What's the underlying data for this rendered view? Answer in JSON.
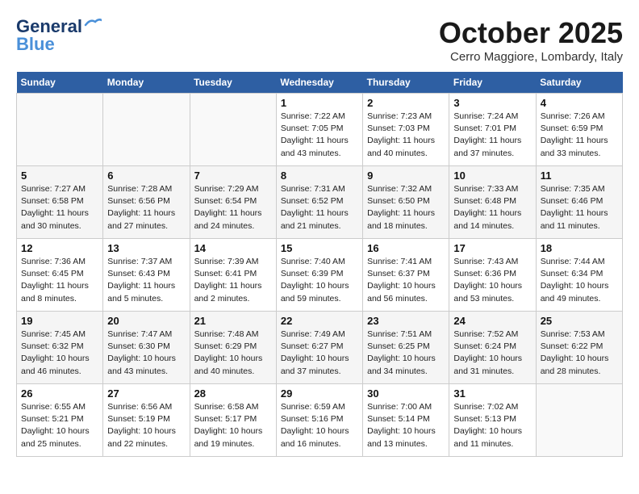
{
  "header": {
    "logo_line1": "General",
    "logo_line2": "Blue",
    "month": "October 2025",
    "location": "Cerro Maggiore, Lombardy, Italy"
  },
  "weekdays": [
    "Sunday",
    "Monday",
    "Tuesday",
    "Wednesday",
    "Thursday",
    "Friday",
    "Saturday"
  ],
  "weeks": [
    [
      {
        "day": "",
        "info": ""
      },
      {
        "day": "",
        "info": ""
      },
      {
        "day": "",
        "info": ""
      },
      {
        "day": "1",
        "info": "Sunrise: 7:22 AM\nSunset: 7:05 PM\nDaylight: 11 hours\nand 43 minutes."
      },
      {
        "day": "2",
        "info": "Sunrise: 7:23 AM\nSunset: 7:03 PM\nDaylight: 11 hours\nand 40 minutes."
      },
      {
        "day": "3",
        "info": "Sunrise: 7:24 AM\nSunset: 7:01 PM\nDaylight: 11 hours\nand 37 minutes."
      },
      {
        "day": "4",
        "info": "Sunrise: 7:26 AM\nSunset: 6:59 PM\nDaylight: 11 hours\nand 33 minutes."
      }
    ],
    [
      {
        "day": "5",
        "info": "Sunrise: 7:27 AM\nSunset: 6:58 PM\nDaylight: 11 hours\nand 30 minutes."
      },
      {
        "day": "6",
        "info": "Sunrise: 7:28 AM\nSunset: 6:56 PM\nDaylight: 11 hours\nand 27 minutes."
      },
      {
        "day": "7",
        "info": "Sunrise: 7:29 AM\nSunset: 6:54 PM\nDaylight: 11 hours\nand 24 minutes."
      },
      {
        "day": "8",
        "info": "Sunrise: 7:31 AM\nSunset: 6:52 PM\nDaylight: 11 hours\nand 21 minutes."
      },
      {
        "day": "9",
        "info": "Sunrise: 7:32 AM\nSunset: 6:50 PM\nDaylight: 11 hours\nand 18 minutes."
      },
      {
        "day": "10",
        "info": "Sunrise: 7:33 AM\nSunset: 6:48 PM\nDaylight: 11 hours\nand 14 minutes."
      },
      {
        "day": "11",
        "info": "Sunrise: 7:35 AM\nSunset: 6:46 PM\nDaylight: 11 hours\nand 11 minutes."
      }
    ],
    [
      {
        "day": "12",
        "info": "Sunrise: 7:36 AM\nSunset: 6:45 PM\nDaylight: 11 hours\nand 8 minutes."
      },
      {
        "day": "13",
        "info": "Sunrise: 7:37 AM\nSunset: 6:43 PM\nDaylight: 11 hours\nand 5 minutes."
      },
      {
        "day": "14",
        "info": "Sunrise: 7:39 AM\nSunset: 6:41 PM\nDaylight: 11 hours\nand 2 minutes."
      },
      {
        "day": "15",
        "info": "Sunrise: 7:40 AM\nSunset: 6:39 PM\nDaylight: 10 hours\nand 59 minutes."
      },
      {
        "day": "16",
        "info": "Sunrise: 7:41 AM\nSunset: 6:37 PM\nDaylight: 10 hours\nand 56 minutes."
      },
      {
        "day": "17",
        "info": "Sunrise: 7:43 AM\nSunset: 6:36 PM\nDaylight: 10 hours\nand 53 minutes."
      },
      {
        "day": "18",
        "info": "Sunrise: 7:44 AM\nSunset: 6:34 PM\nDaylight: 10 hours\nand 49 minutes."
      }
    ],
    [
      {
        "day": "19",
        "info": "Sunrise: 7:45 AM\nSunset: 6:32 PM\nDaylight: 10 hours\nand 46 minutes."
      },
      {
        "day": "20",
        "info": "Sunrise: 7:47 AM\nSunset: 6:30 PM\nDaylight: 10 hours\nand 43 minutes."
      },
      {
        "day": "21",
        "info": "Sunrise: 7:48 AM\nSunset: 6:29 PM\nDaylight: 10 hours\nand 40 minutes."
      },
      {
        "day": "22",
        "info": "Sunrise: 7:49 AM\nSunset: 6:27 PM\nDaylight: 10 hours\nand 37 minutes."
      },
      {
        "day": "23",
        "info": "Sunrise: 7:51 AM\nSunset: 6:25 PM\nDaylight: 10 hours\nand 34 minutes."
      },
      {
        "day": "24",
        "info": "Sunrise: 7:52 AM\nSunset: 6:24 PM\nDaylight: 10 hours\nand 31 minutes."
      },
      {
        "day": "25",
        "info": "Sunrise: 7:53 AM\nSunset: 6:22 PM\nDaylight: 10 hours\nand 28 minutes."
      }
    ],
    [
      {
        "day": "26",
        "info": "Sunrise: 6:55 AM\nSunset: 5:21 PM\nDaylight: 10 hours\nand 25 minutes."
      },
      {
        "day": "27",
        "info": "Sunrise: 6:56 AM\nSunset: 5:19 PM\nDaylight: 10 hours\nand 22 minutes."
      },
      {
        "day": "28",
        "info": "Sunrise: 6:58 AM\nSunset: 5:17 PM\nDaylight: 10 hours\nand 19 minutes."
      },
      {
        "day": "29",
        "info": "Sunrise: 6:59 AM\nSunset: 5:16 PM\nDaylight: 10 hours\nand 16 minutes."
      },
      {
        "day": "30",
        "info": "Sunrise: 7:00 AM\nSunset: 5:14 PM\nDaylight: 10 hours\nand 13 minutes."
      },
      {
        "day": "31",
        "info": "Sunrise: 7:02 AM\nSunset: 5:13 PM\nDaylight: 10 hours\nand 11 minutes."
      },
      {
        "day": "",
        "info": ""
      }
    ]
  ]
}
